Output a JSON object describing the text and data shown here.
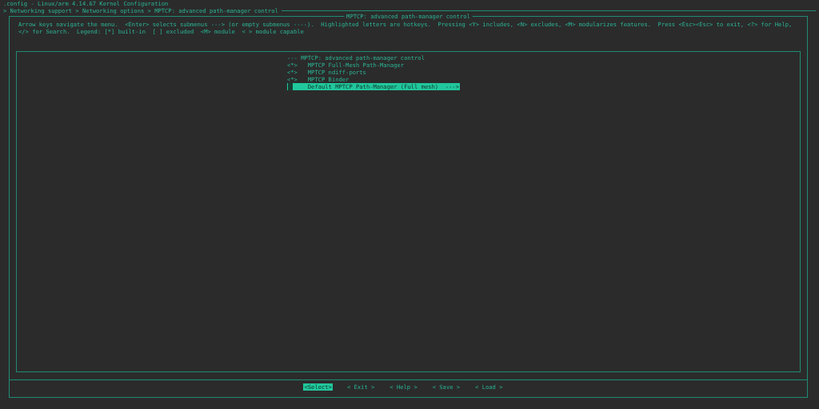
{
  "window": {
    "title": ".config - Linux/arm 4.14.67 Kernel Configuration"
  },
  "breadcrumb": "> Networking support > Networking options > MPTCP: advanced path-manager control",
  "dialog": {
    "title": "MPTCP: advanced path-manager control",
    "help_lines": [
      "Arrow keys navigate the menu.  <Enter> selects submenus ---> (or empty submenus ----).  Highlighted letters are hotkeys.  Pressing <Y> includes, <N> excludes, <M> modularizes features.  Press <Esc><Esc> to exit, <?> for Help,",
      "</> for Search.  Legend: [*] built-in  [ ] excluded  <M> module  < > module capable"
    ],
    "menu": [
      {
        "kind": "comment",
        "prefix": "---",
        "label": "MPTCP: advanced path-manager control",
        "selected": false
      },
      {
        "kind": "option",
        "prefix": "<*>",
        "label": "MPTCP Full-Mesh Path-Manager",
        "selected": false
      },
      {
        "kind": "option",
        "prefix": "<*>",
        "label": "MPTCP ndiff-ports",
        "selected": false
      },
      {
        "kind": "option",
        "prefix": "<*>",
        "label": "MPTCP Binder",
        "selected": false
      },
      {
        "kind": "choice",
        "label": "Default MPTCP Path-Manager (Full mesh)",
        "arrow": "--->",
        "selected": true
      }
    ],
    "buttons": [
      {
        "label": "<Select>",
        "selected": true
      },
      {
        "label": "< Exit >",
        "selected": false
      },
      {
        "label": "< Help >",
        "selected": false
      },
      {
        "label": "< Save >",
        "selected": false
      },
      {
        "label": "< Load >",
        "selected": false
      }
    ]
  }
}
